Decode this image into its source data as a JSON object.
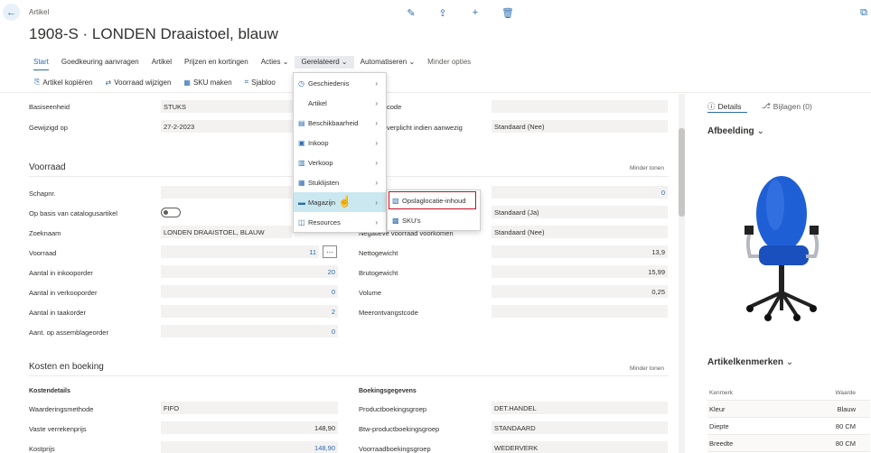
{
  "header": {
    "breadcrumb": "Artikel",
    "title": "1908-S · LONDEN Draaistoel, blauw"
  },
  "nav": {
    "items": [
      "Start",
      "Goedkeuring aanvragen",
      "Artikel",
      "Prijzen en kortingen",
      "Acties",
      "Gerelateerd",
      "Automatiseren",
      "Minder opties"
    ]
  },
  "actions": {
    "items": [
      "Artikel kopiëren",
      "Voorraad wijzigen",
      "SKU maken",
      "Sjabloo"
    ]
  },
  "general": {
    "base_unit_label": "Basiseenheid",
    "base_unit_value": "STUKS",
    "modified_label": "Gewijzigd op",
    "modified_value": "27-2-2023",
    "right_label_1": "code",
    "right_label_2": "verplicht indien aanwezig",
    "right_value_2": "Standaard (Nee)"
  },
  "inventory": {
    "title": "Voorraad",
    "toggle": "Minder tonen",
    "shelf_label": "Schapnr.",
    "catalog_label": "Op basis van catalogusartikel",
    "search_label": "Zoeknaam",
    "search_value": "LONDEN DRAAISTOEL, BLAUW",
    "stock_label": "Voorraad",
    "stock_value": "11",
    "purch_label": "Aantal in inkooporder",
    "purch_value": "20",
    "sales_label": "Aantal in verkooporder",
    "sales_value": "0",
    "job_label": "Aantal in taakorder",
    "job_value": "2",
    "asm_label": "Aant. op assemblageorder",
    "asm_value": "0",
    "r1_value": "0",
    "r2_value": "Standaard (Ja)",
    "neg_label": "Negatieve voorraad voorkomen",
    "neg_value": "Standaard (Nee)",
    "net_label": "Nettogewicht",
    "net_value": "13,9",
    "gross_label": "Brutogewicht",
    "gross_value": "15,99",
    "vol_label": "Volume",
    "vol_value": "0,25",
    "rec_label": "Meerontvangstcode"
  },
  "costs": {
    "title": "Kosten en boeking",
    "toggle": "Minder tonen",
    "details_title": "Kostendetails",
    "method_label": "Waarderingsmethode",
    "method_value": "FIFO",
    "unit_cost_label": "Vaste verrekenprijs",
    "unit_cost_value": "148,90",
    "cost_label": "Kostprijs",
    "cost_value": "148,90",
    "posting_title": "Boekingsgegevens",
    "prod_label": "Productboekingsgroep",
    "prod_value": "DET.HANDEL",
    "vat_label": "Btw-productboekingsgroep",
    "vat_value": "STANDAARD",
    "inv_label": "Voorraadboekingsgroep",
    "inv_value": "WEDERVERK"
  },
  "menu": {
    "items": [
      "Geschiedenis",
      "Artikel",
      "Beschikbaarheid",
      "Inkoop",
      "Verkoop",
      "Stuklijsten",
      "Magazijn",
      "Resources"
    ],
    "submenu": [
      "Opslaglocatie-inhoud",
      "SKU's"
    ]
  },
  "factbox": {
    "tab_details": "Details",
    "tab_attachments": "Bijlagen (0)",
    "image_title": "Afbeelding",
    "attr_title": "Artikelkenmerken",
    "attr_head_1": "Kenmerk",
    "attr_head_2": "Waarde",
    "attrs": [
      {
        "k": "Kleur",
        "v": "Blauw"
      },
      {
        "k": "Diepte",
        "v": "80 CM"
      },
      {
        "k": "Breedte",
        "v": "80 CM"
      }
    ]
  },
  "colors": {
    "accent": "#2b6cb0",
    "highlight": "#cbe8f0",
    "red_box": "#c50f1f"
  }
}
